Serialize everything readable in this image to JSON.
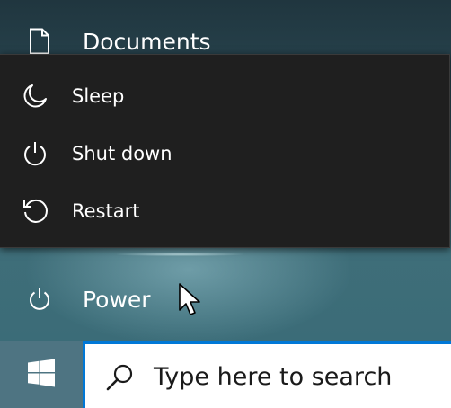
{
  "start_menu": {
    "items": [
      {
        "label": "Documents",
        "icon": "document-icon"
      },
      {
        "label": "Power",
        "icon": "power-icon"
      }
    ]
  },
  "power_menu": {
    "items": [
      {
        "label": "Sleep",
        "icon": "moon-icon"
      },
      {
        "label": "Shut down",
        "icon": "power-icon"
      },
      {
        "label": "Restart",
        "icon": "restart-icon"
      }
    ]
  },
  "taskbar": {
    "start_icon": "windows-logo-icon",
    "search": {
      "placeholder": "Type here to search",
      "icon": "search-icon"
    }
  },
  "colors": {
    "menu_background": "#1f1f1f",
    "accent": "#0078d7",
    "taskbar": "#4b6f7d"
  }
}
